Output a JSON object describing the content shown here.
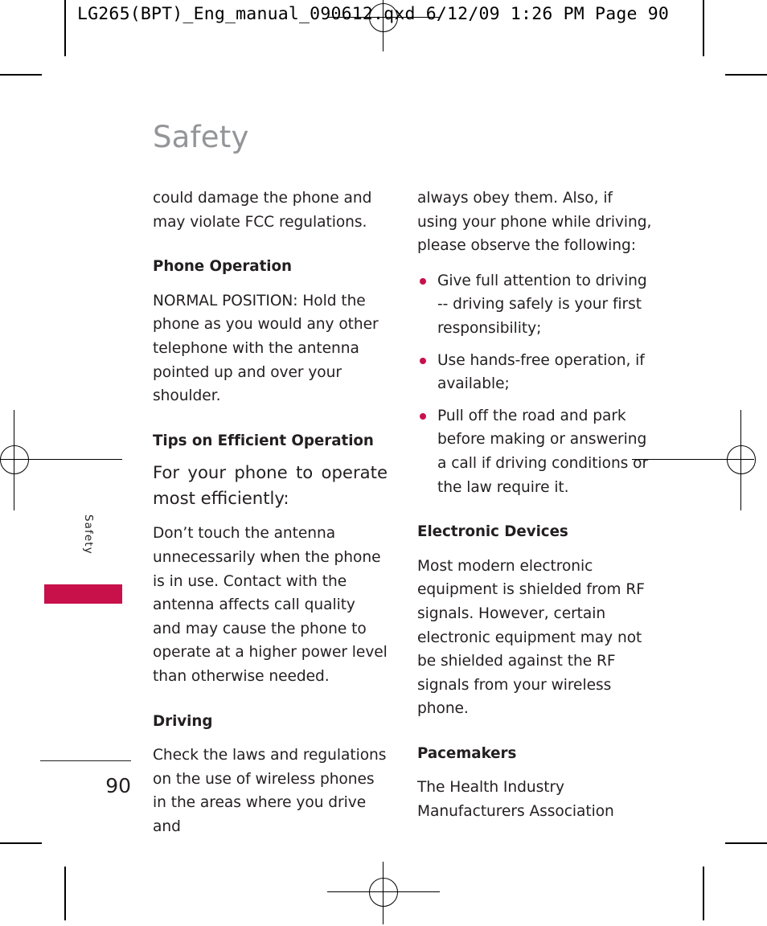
{
  "prepress": {
    "slug_line": "LG265(BPT)_Eng_manual_090612.qxd   6/12/09   1:26 PM   Page 90"
  },
  "page": {
    "title": "Safety",
    "page_number": "90",
    "side_tab_label": "Safety",
    "accent_color": "#c8104b",
    "title_color": "#939598"
  },
  "left_column": {
    "continued_paragraph": "could damage the phone and may violate FCC regulations.",
    "sections": [
      {
        "heading": "Phone Operation",
        "paragraph": "NORMAL POSITION: Hold the phone as you would any other telephone with the antenna pointed up and over your shoulder."
      },
      {
        "heading": "Tips on Efficient Operation",
        "lead": "For your phone to operate most efficiently:",
        "paragraph": "Don’t touch the antenna unnecessarily when the phone is in use. Contact with the antenna affects call quality and may cause the phone to operate at a higher power level than otherwise needed."
      },
      {
        "heading": "Driving",
        "paragraph": "Check the laws and regulations on the use of wireless phones in the areas where you drive and"
      }
    ]
  },
  "right_column": {
    "continued_paragraph": "always obey them. Also, if using your phone while driving, please observe the following:",
    "bullets": [
      "Give full attention to driving -- driving safely is your first responsibility;",
      "Use hands-free operation, if available;",
      "Pull off the road and park before making or answering a call if driving conditions or the law require it."
    ],
    "sections": [
      {
        "heading": "Electronic Devices",
        "paragraph": "Most modern electronic equipment is shielded from RF signals. However, certain electronic equipment may not be shielded against the RF signals from your wireless phone."
      },
      {
        "heading": "Pacemakers",
        "paragraph": "The Health Industry Manufacturers Association"
      }
    ]
  }
}
